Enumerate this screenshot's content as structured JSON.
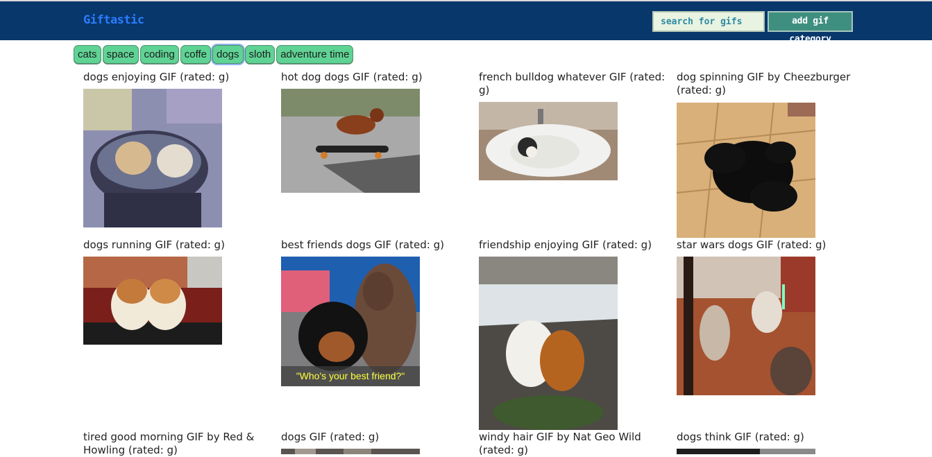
{
  "brand": "Giftastic",
  "search": {
    "placeholder": "search for gifs"
  },
  "add_button": "add gif category",
  "categories": [
    "cats",
    "space",
    "coding",
    "coffe",
    "dogs",
    "sloth",
    "adventure time"
  ],
  "active_category": "dogs",
  "gifs": [
    {
      "caption": "dogs enjoying GIF (rated: g)"
    },
    {
      "caption": "hot dog dogs GIF (rated: g)"
    },
    {
      "caption": "french bulldog whatever GIF (rated: g)"
    },
    {
      "caption": "dog spinning GIF by Cheezburger (rated: g)"
    },
    {
      "caption": "dogs running GIF (rated: g)"
    },
    {
      "caption": "best friends dogs GIF (rated: g)",
      "overlay_text": "\"Who's your best friend?\""
    },
    {
      "caption": "friendship enjoying GIF (rated: g)"
    },
    {
      "caption": "star wars dogs GIF (rated: g)"
    },
    {
      "caption": "tired good morning GIF by Red & Howling (rated: g)"
    },
    {
      "caption": "dogs GIF (rated: g)"
    },
    {
      "caption": "windy hair GIF by Nat Geo Wild (rated: g)"
    },
    {
      "caption": "dogs think GIF (rated: g)"
    }
  ]
}
